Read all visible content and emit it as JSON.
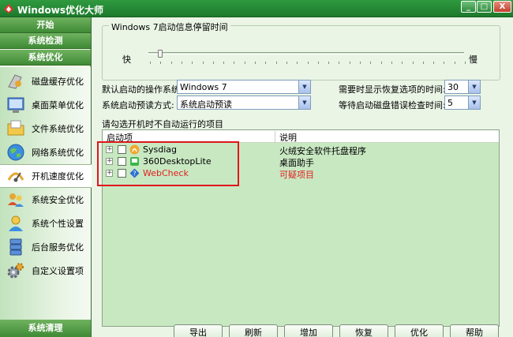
{
  "window": {
    "title": "Windows优化大师",
    "minimize": "_",
    "maximize": "□",
    "close": "X"
  },
  "sidebar": {
    "sections": [
      "开始",
      "系统检测",
      "系统优化"
    ],
    "items": [
      {
        "label": "磁盘缓存优化",
        "icon": "disk-cache-icon"
      },
      {
        "label": "桌面菜单优化",
        "icon": "desktop-menu-icon"
      },
      {
        "label": "文件系统优化",
        "icon": "folder-icon"
      },
      {
        "label": "网络系统优化",
        "icon": "globe-icon"
      },
      {
        "label": "开机速度优化",
        "icon": "startup-speed-icon",
        "active": true
      },
      {
        "label": "系统安全优化",
        "icon": "security-users-icon"
      },
      {
        "label": "系统个性设置",
        "icon": "personalize-icon"
      },
      {
        "label": "后台服务优化",
        "icon": "services-icon"
      },
      {
        "label": "自定义设置项",
        "icon": "gears-icon"
      }
    ],
    "bottom_section": "系统清理"
  },
  "main": {
    "group_title": "Windows 7启动信息停留时间",
    "slider": {
      "fast": "快",
      "slow": "慢",
      "value_fraction": 0.0
    },
    "default_os_label": "默认启动的操作系统:",
    "default_os_value": "Windows 7",
    "boot_mode_label": "系统启动预读方式:",
    "boot_mode_value": "系统启动预读",
    "restore_time_label": "需要时显示恢复选项的时间:",
    "restore_time_value": "30",
    "disk_check_label": "等待启动磁盘错误检查时间:",
    "disk_check_value": "5",
    "hint": "请勾选开机时不自动运行的项目",
    "columns": {
      "startup": "启动项",
      "desc": "说明"
    },
    "rows": [
      {
        "name": "Sysdiag",
        "desc": "火绒安全软件托盘程序",
        "suspicious": false
      },
      {
        "name": "360DesktopLite",
        "desc": "桌面助手",
        "suspicious": false
      },
      {
        "name": "WebCheck",
        "desc": "可疑项目",
        "suspicious": true
      }
    ],
    "buttons": [
      "导出",
      "刷新",
      "增加",
      "恢复",
      "优化",
      "帮助"
    ]
  },
  "colors": {
    "accent": "#2f9a3f",
    "highlight": "#e0161c",
    "suspicious": "#e02020",
    "list_bg": "#c8e8c2"
  }
}
